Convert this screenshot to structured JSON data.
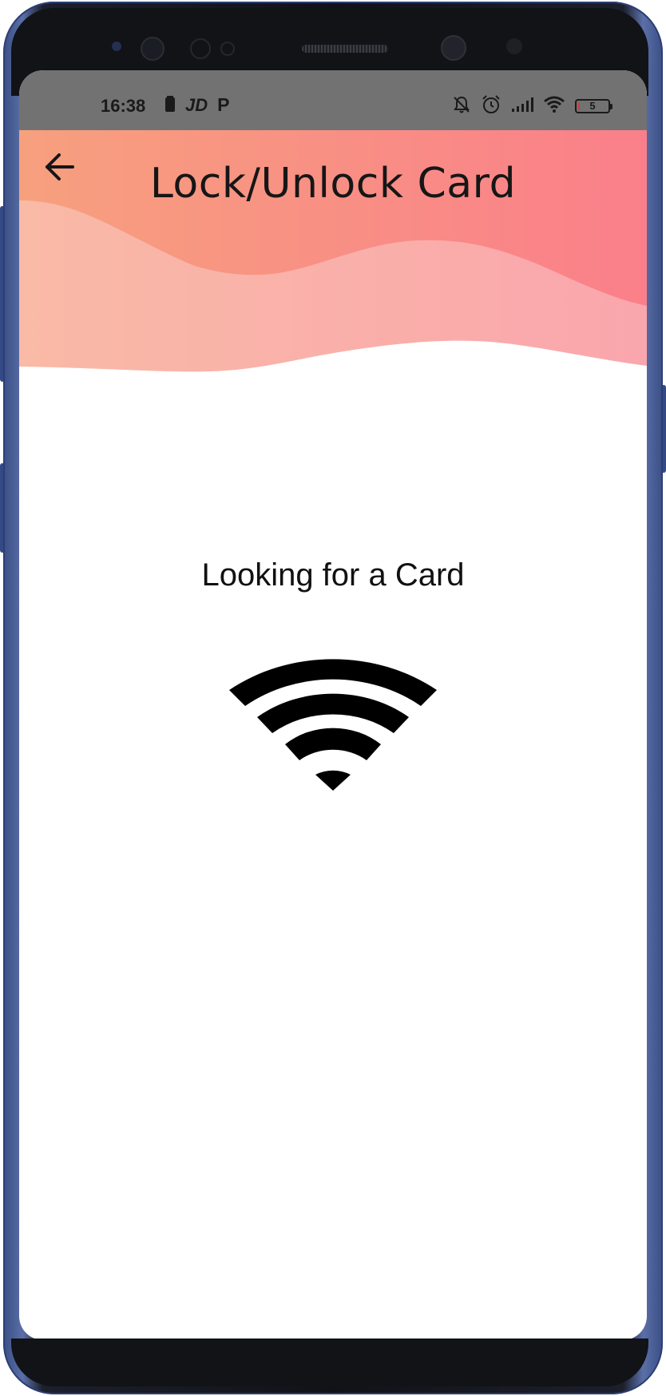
{
  "status_bar": {
    "time": "16:38",
    "left_icons": [
      "battery-saver-icon",
      "jd-app-icon",
      "parking-app-icon"
    ],
    "left_labels": [
      "JD",
      "P"
    ],
    "right_icons": [
      "bell-off-icon",
      "alarm-icon",
      "signal-icon",
      "wifi-status-icon",
      "battery-icon"
    ],
    "battery_text": "5",
    "battery_level_percent": 5
  },
  "header": {
    "title": "Lock/Unlock Card",
    "back_icon": "arrow-left-icon",
    "gradient_colors": [
      "#f7a07e",
      "#fa7f8a"
    ],
    "wave_light_colors": [
      "#f9baa6",
      "#faa6ad"
    ]
  },
  "content": {
    "status_message": "Looking for a Card",
    "scan_icon": "nfc-signal-icon"
  }
}
